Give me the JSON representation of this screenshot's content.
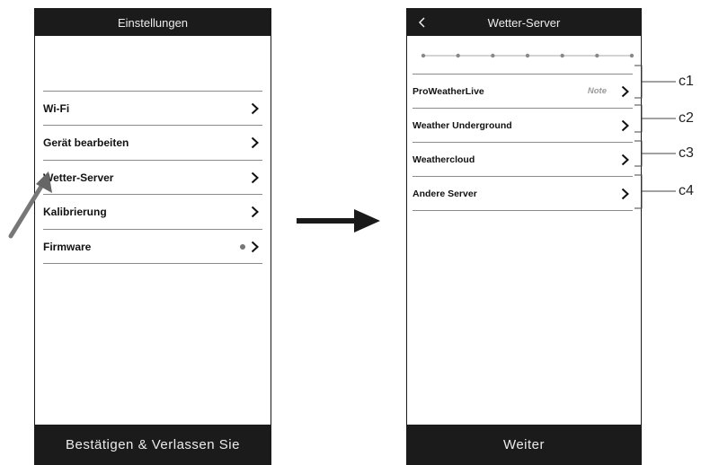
{
  "left_screen": {
    "title": "Einstellungen",
    "items": [
      {
        "label": "Wi-Fi",
        "has_dot": false
      },
      {
        "label": "Gerät bearbeiten",
        "has_dot": false
      },
      {
        "label": "Wetter-Server",
        "has_dot": false
      },
      {
        "label": "Kalibrierung",
        "has_dot": false
      },
      {
        "label": "Firmware",
        "has_dot": true
      }
    ],
    "bottom_button": "Bestätigen & Verlassen Sie"
  },
  "right_screen": {
    "title": "Wetter-Server",
    "stepper_dots": 7,
    "servers": [
      {
        "label": "ProWeatherLive",
        "note": "Note",
        "callout": "c1"
      },
      {
        "label": "Weather Underground",
        "note": "",
        "callout": "c2"
      },
      {
        "label": "Weathercloud",
        "note": "",
        "callout": "c3"
      },
      {
        "label": "Andere Server",
        "note": "",
        "callout": "c4"
      }
    ],
    "bottom_button": "Weiter"
  },
  "icons": {
    "back": "chevron-left-icon",
    "row_arrow": "chevron-right-icon",
    "pointer": "pointer-arrow-icon",
    "transition": "transition-arrow-icon"
  },
  "colors": {
    "bar_background": "#1b1b1b",
    "bar_text": "#ececec",
    "divider": "#8a8a8a",
    "note_text": "#9a9a9a"
  }
}
